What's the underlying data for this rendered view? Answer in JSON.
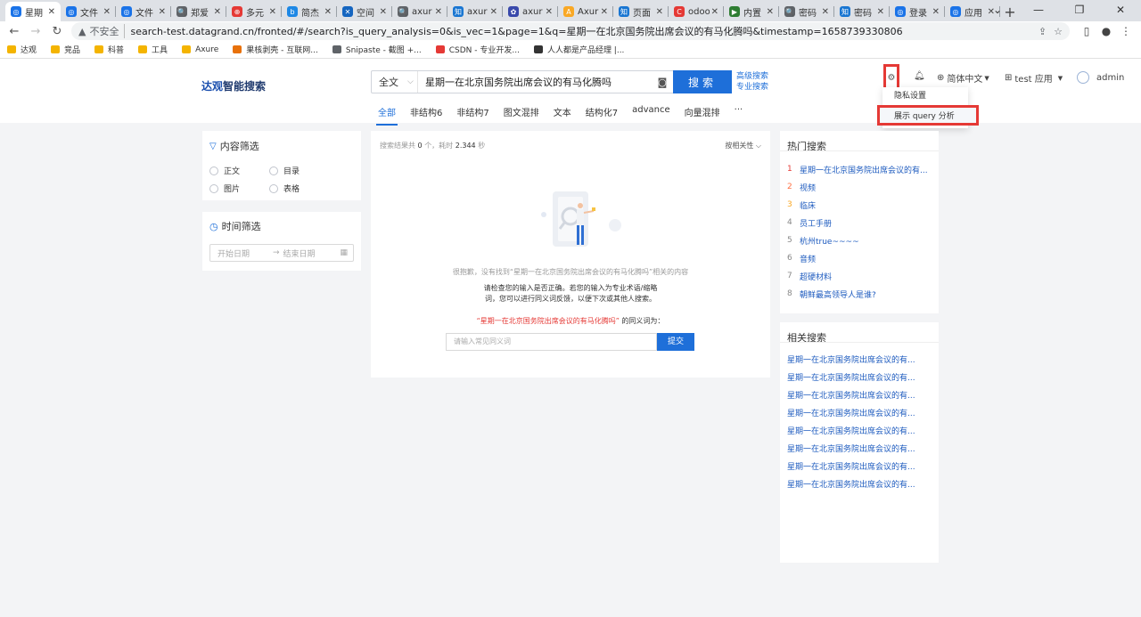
{
  "browser": {
    "tabs": [
      {
        "label": "星期",
        "color": "#1a73e8",
        "glyph": "◎"
      },
      {
        "label": "文件",
        "color": "#1a73e8",
        "glyph": "◎"
      },
      {
        "label": "文件",
        "color": "#1a73e8",
        "glyph": "◎"
      },
      {
        "label": "郑爱",
        "color": "#5f6368",
        "glyph": "🔍"
      },
      {
        "label": "多元",
        "color": "#e53935",
        "glyph": "⊕"
      },
      {
        "label": "简杰",
        "color": "#1e88e5",
        "glyph": "b"
      },
      {
        "label": "空间",
        "color": "#1565c0",
        "glyph": "✕"
      },
      {
        "label": "axur",
        "color": "#5f6368",
        "glyph": "🔍"
      },
      {
        "label": "axur",
        "color": "#1976d2",
        "glyph": "知"
      },
      {
        "label": "axur",
        "color": "#3949ab",
        "glyph": "✿"
      },
      {
        "label": "Axur",
        "color": "#f9a825",
        "glyph": "A"
      },
      {
        "label": "页面",
        "color": "#1976d2",
        "glyph": "知"
      },
      {
        "label": "odoo",
        "color": "#e53935",
        "glyph": "C"
      },
      {
        "label": "内置",
        "color": "#2e7d32",
        "glyph": "▶"
      },
      {
        "label": "密码",
        "color": "#5f6368",
        "glyph": "🔍"
      },
      {
        "label": "密码",
        "color": "#1976d2",
        "glyph": "知"
      },
      {
        "label": "登录",
        "color": "#1a73e8",
        "glyph": "◎"
      },
      {
        "label": "应用",
        "color": "#1a73e8",
        "glyph": "◎"
      }
    ],
    "insecure_label": "不安全",
    "url": "search-test.datagrand.cn/fronted/#/search?is_query_analysis=0&is_vec=1&page=1&q=星期一在北京国务院出席会议的有马化腾吗&timestamp=1658739330806",
    "bookmarks": [
      {
        "label": "达观",
        "color": "#f4b400"
      },
      {
        "label": "竞品",
        "color": "#f4b400"
      },
      {
        "label": "科普",
        "color": "#f4b400"
      },
      {
        "label": "工具",
        "color": "#f4b400"
      },
      {
        "label": "Axure",
        "color": "#f4b400"
      },
      {
        "label": "果核剥壳 - 互联网...",
        "color": "#e8710a"
      },
      {
        "label": "Snipaste - 截图 +...",
        "color": "#5f6368"
      },
      {
        "label": "CSDN - 专业开发...",
        "color": "#e53935"
      },
      {
        "label": "人人都是产品经理 |...",
        "color": "#333333"
      }
    ]
  },
  "header": {
    "logo_brand": "达观",
    "logo_text": "智能搜索",
    "scope": "全文",
    "query": "星期一在北京国务院出席会议的有马化腾吗",
    "search_button": "搜索",
    "advanced_search": "高级搜索",
    "pro_search": "专业搜索",
    "nav_tabs": [
      "全部",
      "非结构6",
      "非结构7",
      "图文混排",
      "文本",
      "结构化7",
      "advance",
      "向量混排",
      "···"
    ],
    "language": "简体中文",
    "app": "test 应用",
    "user": "admin",
    "settings_menu": [
      "隐私设置",
      "展示 query 分析"
    ]
  },
  "filters": {
    "content_title": "内容筛选",
    "content_options": [
      "正文",
      "目录",
      "图片",
      "表格"
    ],
    "time_title": "时间筛选",
    "start_placeholder": "开始日期",
    "arrow": "→",
    "end_placeholder": "结束日期"
  },
  "results": {
    "summary_prefix": "搜索结果共",
    "count": "0",
    "summary_mid": "个，耗时",
    "time": "2.344",
    "summary_suffix": "秒",
    "sort": "按相关性",
    "empty_line1": "很抱歉，没有找到“星期一在北京国务院出席会议的有马化腾吗”相关的内容",
    "empty_line2": "请检查您的输入是否正确。若您的输入为专业术语/缩略",
    "empty_line3": "词，您可以进行同义词反馈，以便下次或其他人搜索。",
    "synonym_query": "“星期一在北京国务院出席会议的有马化腾吗”",
    "synonym_suffix": "的同义词为：",
    "synonym_placeholder": "请输入常见同义词",
    "submit_button": "提交"
  },
  "hot_search": {
    "title": "热门搜索",
    "items": [
      {
        "rank": "1",
        "text": "星期一在北京国务院出席会议的有...",
        "rank_color": "#e53935"
      },
      {
        "rank": "2",
        "text": "视频",
        "rank_color": "#ff7043"
      },
      {
        "rank": "3",
        "text": "临床",
        "rank_color": "#f9a825"
      },
      {
        "rank": "4",
        "text": "员工手册",
        "rank_color": "#888888"
      },
      {
        "rank": "5",
        "text": "杭州true~~~~",
        "rank_color": "#888888"
      },
      {
        "rank": "6",
        "text": "音频",
        "rank_color": "#888888"
      },
      {
        "rank": "7",
        "text": "超硬材料",
        "rank_color": "#888888"
      },
      {
        "rank": "8",
        "text": "朝鲜最高领导人是谁?",
        "rank_color": "#888888"
      }
    ]
  },
  "related_search": {
    "title": "相关搜索",
    "items": [
      "星期一在北京国务院出席会议的有...",
      "星期一在北京国务院出席会议的有...",
      "星期一在北京国务院出席会议的有...",
      "星期一在北京国务院出席会议的有...",
      "星期一在北京国务院出席会议的有...",
      "星期一在北京国务院出席会议的有...",
      "星期一在北京国务院出席会议的有...",
      "星期一在北京国务院出席会议的有..."
    ]
  },
  "colors": {
    "accent": "#1e6fd9",
    "highlight_box": "#e53935"
  }
}
